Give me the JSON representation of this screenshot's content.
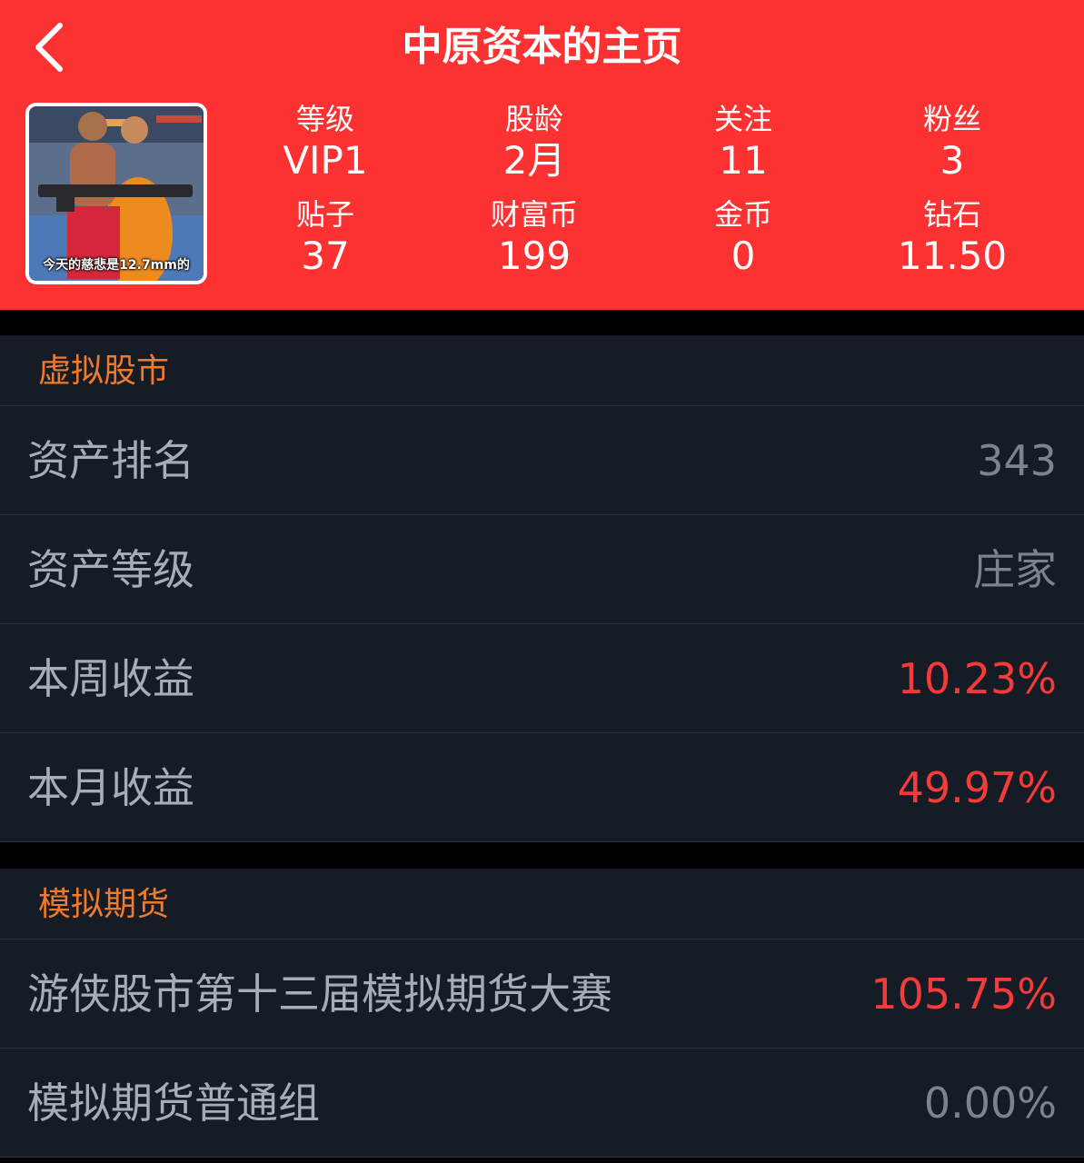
{
  "header": {
    "title": "中原资本的主页",
    "back_icon": "chevron-left-icon",
    "background": "#fc3131"
  },
  "avatar": {
    "caption": "今天的慈悲是12.7mm的"
  },
  "stats": [
    {
      "label": "等级",
      "value": "VIP1"
    },
    {
      "label": "股龄",
      "value": "2月"
    },
    {
      "label": "关注",
      "value": "11"
    },
    {
      "label": "粉丝",
      "value": "3"
    },
    {
      "label": "贴子",
      "value": "37"
    },
    {
      "label": "财富币",
      "value": "199"
    },
    {
      "label": "金币",
      "value": "0"
    },
    {
      "label": "钻石",
      "value": "11.50"
    }
  ],
  "sections": [
    {
      "title": "虚拟股市",
      "rows": [
        {
          "label": "资产排名",
          "value": "343"
        },
        {
          "label": "资产等级",
          "value": "庄家"
        },
        {
          "label": "本周收益",
          "value": "10.23%"
        },
        {
          "label": "本月收益",
          "value": "49.97%"
        }
      ]
    },
    {
      "title": "模拟期货",
      "rows": [
        {
          "label": "游侠股市第十三届模拟期货大赛",
          "value": "105.75%"
        },
        {
          "label": "模拟期货普通组",
          "value": "0.00%"
        }
      ]
    }
  ],
  "colors": {
    "section_title": "#f07a2c",
    "positive": "#f53a3a",
    "neutral": "#7b838d",
    "row_bg": "#161c25",
    "page_bg": "#000000"
  }
}
